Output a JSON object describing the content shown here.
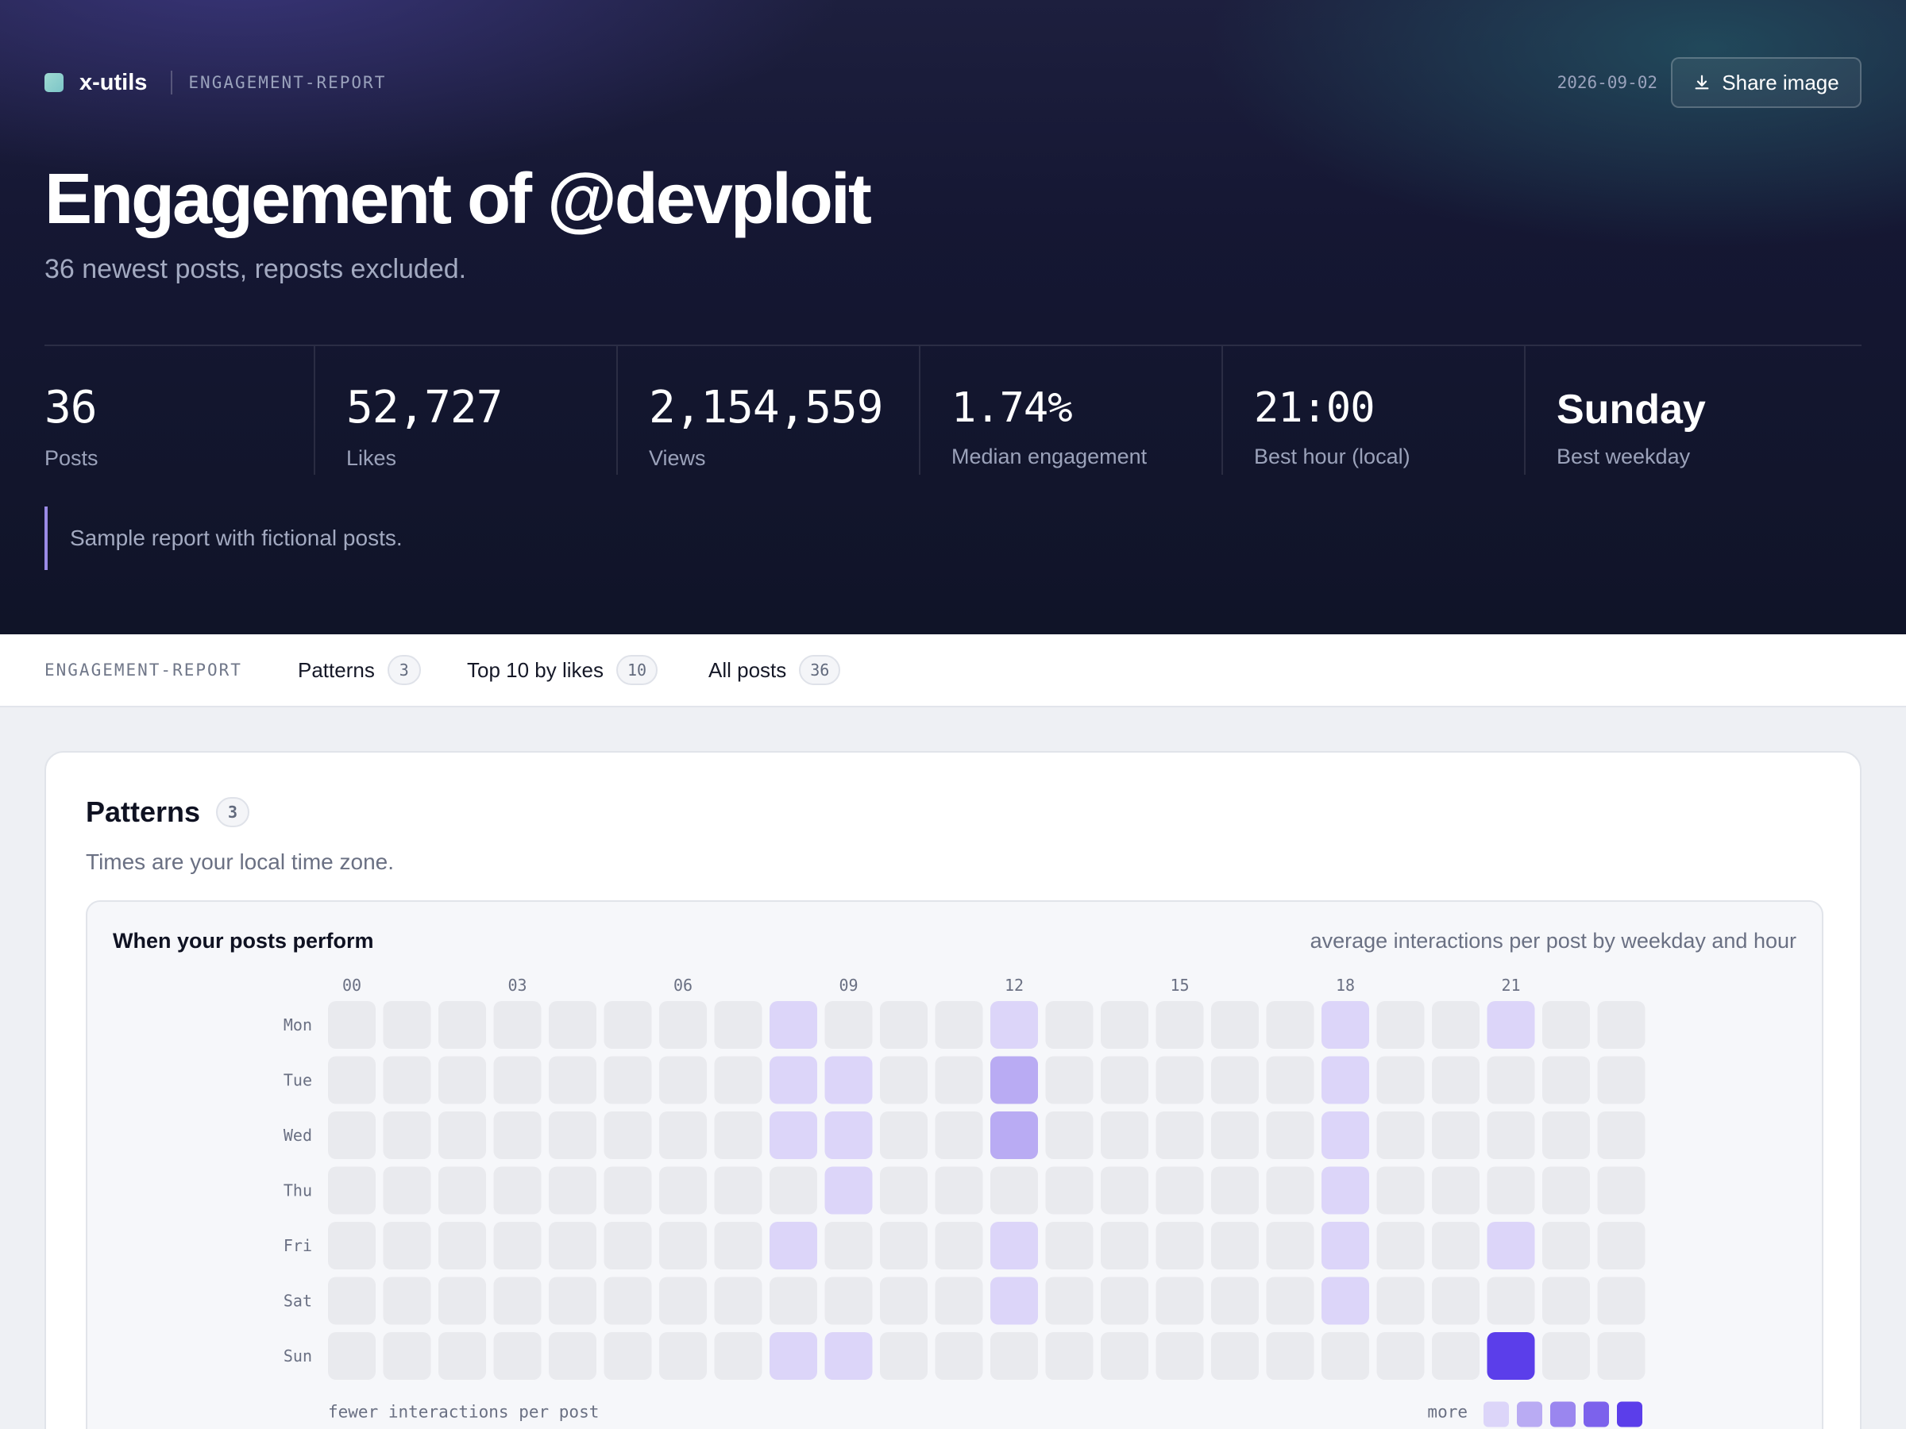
{
  "header": {
    "brand": "x-utils",
    "tag": "ENGAGEMENT-REPORT",
    "date": "2026-09-02",
    "share_label": "Share image",
    "title": "Engagement of @devploit",
    "subtitle": "36 newest posts, reposts excluded.",
    "note": "Sample report with fictional posts."
  },
  "stats": [
    {
      "value": "36",
      "label": "Posts"
    },
    {
      "value": "52,727",
      "label": "Likes"
    },
    {
      "value": "2,154,559",
      "label": "Views"
    },
    {
      "value": "1.74%",
      "label": "Median engagement"
    },
    {
      "value": "21:00",
      "label": "Best hour (local)"
    },
    {
      "value": "Sunday",
      "label": "Best weekday"
    }
  ],
  "tabbar": {
    "tag": "ENGAGEMENT-REPORT",
    "tabs": [
      {
        "label": "Patterns",
        "count": "3"
      },
      {
        "label": "Top 10 by likes",
        "count": "10"
      },
      {
        "label": "All posts",
        "count": "36"
      }
    ]
  },
  "patterns": {
    "title": "Patterns",
    "count": "3",
    "subtitle": "Times are your local time zone.",
    "heatmap_title": "When your posts perform",
    "heatmap_desc": "average interactions per post by weekday and hour",
    "legend_low": "fewer interactions per post",
    "legend_high": "more"
  },
  "colors": {
    "empty": "#e9eaee",
    "levels": [
      "#dcd5f9",
      "#b9abf3",
      "#9a86ef",
      "#7c62ec",
      "#5b3eea"
    ]
  },
  "chart_data": {
    "type": "heatmap",
    "title": "When your posts perform",
    "subtitle": "average interactions per post by weekday and hour",
    "hour_ticks": [
      "00",
      "03",
      "06",
      "09",
      "12",
      "15",
      "18",
      "21"
    ],
    "x": [
      0,
      1,
      2,
      3,
      4,
      5,
      6,
      7,
      8,
      9,
      10,
      11,
      12,
      13,
      14,
      15,
      16,
      17,
      18,
      19,
      20,
      21,
      22,
      23
    ],
    "y": [
      "Mon",
      "Tue",
      "Wed",
      "Thu",
      "Fri",
      "Sat",
      "Sun"
    ],
    "scale": "level 0 = no posts, 1-5 = intensity",
    "values": [
      [
        0,
        0,
        0,
        0,
        0,
        0,
        0,
        0,
        1,
        0,
        0,
        0,
        1,
        0,
        0,
        0,
        0,
        0,
        1,
        0,
        0,
        1,
        0,
        0
      ],
      [
        0,
        0,
        0,
        0,
        0,
        0,
        0,
        0,
        1,
        1,
        0,
        0,
        2,
        0,
        0,
        0,
        0,
        0,
        1,
        0,
        0,
        0,
        0,
        0
      ],
      [
        0,
        0,
        0,
        0,
        0,
        0,
        0,
        0,
        1,
        1,
        0,
        0,
        2,
        0,
        0,
        0,
        0,
        0,
        1,
        0,
        0,
        0,
        0,
        0
      ],
      [
        0,
        0,
        0,
        0,
        0,
        0,
        0,
        0,
        0,
        1,
        0,
        0,
        0,
        0,
        0,
        0,
        0,
        0,
        1,
        0,
        0,
        0,
        0,
        0
      ],
      [
        0,
        0,
        0,
        0,
        0,
        0,
        0,
        0,
        1,
        0,
        0,
        0,
        1,
        0,
        0,
        0,
        0,
        0,
        1,
        0,
        0,
        1,
        0,
        0
      ],
      [
        0,
        0,
        0,
        0,
        0,
        0,
        0,
        0,
        0,
        0,
        0,
        0,
        1,
        0,
        0,
        0,
        0,
        0,
        1,
        0,
        0,
        0,
        0,
        0
      ],
      [
        0,
        0,
        0,
        0,
        0,
        0,
        0,
        0,
        1,
        1,
        0,
        0,
        0,
        0,
        0,
        0,
        0,
        0,
        0,
        0,
        0,
        5,
        0,
        0
      ]
    ]
  }
}
